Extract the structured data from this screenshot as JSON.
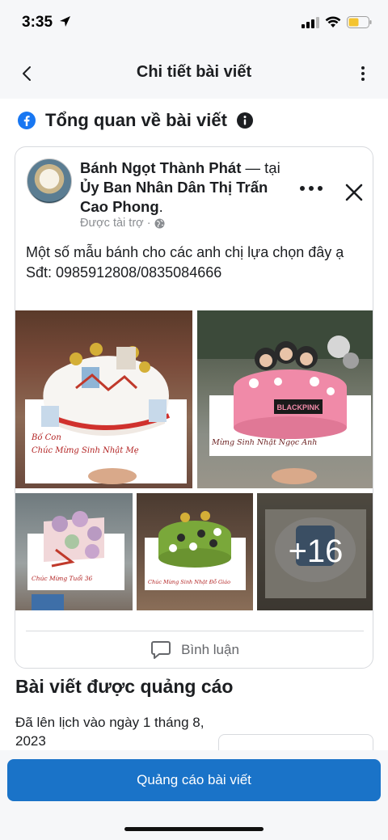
{
  "status_bar": {
    "time": "3:35",
    "battery_color": "#f4c430"
  },
  "nav": {
    "title": "Chi tiết bài viết"
  },
  "overview": {
    "title": "Tổng quan về bài viết"
  },
  "post": {
    "page_name": "Bánh Ngọt Thành Phát",
    "location_prefix": " — tại ",
    "location": "Ủy Ban Nhân Dân Thị Trấn Cao Phong",
    "location_suffix": ".",
    "sponsored": "Được tài trợ ·",
    "text_line1": "Một số mẫu bánh cho các anh chị lựa chọn đây ạ",
    "text_line2": "Sđt: 0985912808/0835084666",
    "photos": [
      {
        "cake_text": "Chúc Mừng Sinh Nhật Mẹ",
        "top_text": "Bố Con"
      },
      {
        "cake_text": "Mừng Sinh Nhật Ngọc Anh",
        "plaque_text": "BLACKPINK"
      },
      {
        "cake_text": "Chúc Mừng Tuổi 36"
      },
      {
        "cake_text": "Chúc Mừng Sinh Nhật Đỗ Giáo"
      },
      {
        "cake_text": ""
      }
    ],
    "more_count": "+16",
    "comment_label": "Bình luận"
  },
  "promoted": {
    "title": "Bài viết được quảng cáo",
    "scheduled": "Đã lên lịch vào ngày 1 tháng 8, 2023"
  },
  "footer": {
    "button_label": "Quảng cáo bài viết"
  },
  "colors": {
    "accent": "#1a73c8",
    "facebook": "#1877f2"
  }
}
